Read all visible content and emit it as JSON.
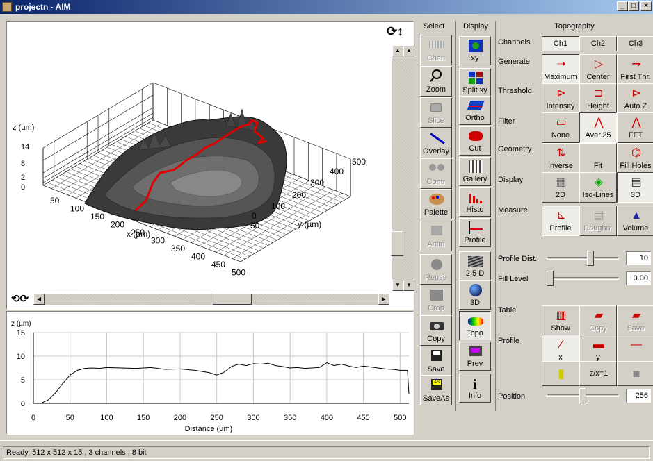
{
  "window": {
    "title": "projectn - AIM",
    "buttons": {
      "minimize": "_",
      "maximize": "□",
      "close": "×"
    }
  },
  "plot3d": {
    "z_label": "z (µm)",
    "x_label": "x (µm)",
    "y_label": "y (µm)",
    "z_ticks": [
      "14",
      "8",
      "2",
      "0"
    ],
    "x_ticks": [
      "50",
      "100",
      "150",
      "200",
      "250",
      "300",
      "350",
      "400",
      "450",
      "500"
    ],
    "y_ticks": [
      "0",
      "100",
      "200",
      "300",
      "400",
      "500"
    ],
    "y_ticks_alt": [
      "50"
    ]
  },
  "chart_data": {
    "type": "line",
    "title": "",
    "xlabel": "Distance (µm)",
    "ylabel": "z (µm)",
    "xlim": [
      0,
      512
    ],
    "ylim": [
      0,
      15
    ],
    "x_ticks": [
      0,
      50,
      100,
      150,
      200,
      250,
      300,
      350,
      400,
      450,
      500
    ],
    "y_ticks": [
      0,
      5,
      10,
      15
    ],
    "grid": true,
    "series": [
      {
        "x": [
          0,
          10,
          20,
          30,
          40,
          50,
          60,
          70,
          80,
          90,
          100,
          120,
          140,
          160,
          180,
          200,
          220,
          240,
          250,
          260,
          270,
          280,
          290,
          300,
          310,
          320,
          330,
          340,
          350,
          360,
          370,
          380,
          390,
          400,
          410,
          420,
          430,
          440,
          450,
          460,
          470,
          480,
          490,
          500,
          510,
          512
        ],
        "y": [
          0,
          0,
          0.7,
          2.2,
          4.2,
          6.0,
          7.0,
          7.4,
          7.5,
          7.4,
          7.6,
          7.5,
          7.4,
          7.6,
          7.2,
          7.3,
          7.0,
          6.5,
          6.0,
          6.6,
          7.8,
          8.3,
          8.0,
          8.4,
          8.3,
          8.5,
          8.0,
          7.8,
          7.5,
          7.6,
          7.4,
          7.5,
          7.6,
          8.6,
          8.0,
          8.3,
          7.9,
          7.6,
          7.9,
          7.7,
          7.5,
          7.3,
          7.2,
          7.0,
          7.0,
          2.0
        ]
      }
    ]
  },
  "select_col": {
    "header": "Select",
    "buttons": [
      "Chan",
      "Zoom",
      "Slice",
      "Overlay",
      "Contr",
      "Palette",
      "Anim",
      "Reuse",
      "Crop",
      "Copy",
      "Save",
      "SaveAs"
    ]
  },
  "display_col": {
    "header": "Display",
    "buttons": [
      "xy",
      "Split xy",
      "Ortho",
      "Cut",
      "Gallery",
      "Histo",
      "Profile",
      "2.5 D",
      "3D",
      "Topo",
      "Prev",
      "Info"
    ]
  },
  "topography": {
    "header": "Topography",
    "rows": {
      "channels": "Channels",
      "generate": "Generate",
      "threshold": "Threshold",
      "filter": "Filter",
      "geometry": "Geometry",
      "display": "Display",
      "measure": "Measure",
      "profile_dist": "Profile Dist.",
      "fill_level": "Fill Level",
      "table": "Table",
      "profile": "Profile",
      "position": "Position"
    },
    "channels": [
      "Ch1",
      "Ch2",
      "Ch3"
    ],
    "generate": [
      "Maximum",
      "Center",
      "First Thr."
    ],
    "threshold": [
      "Intensity",
      "Height",
      "Auto Z"
    ],
    "filter": [
      "None",
      "Aver.25",
      "FFT"
    ],
    "geometry": [
      "Inverse",
      "Fit",
      "Fill Holes"
    ],
    "display": [
      "2D",
      "Iso-Lines",
      "3D"
    ],
    "measure": [
      "Profile",
      "Roughn.",
      "Volume"
    ],
    "table": [
      "Show",
      "Copy",
      "Save"
    ],
    "profile_sub": [
      "x",
      "y",
      ""
    ],
    "profile_dist_value": "10",
    "fill_level_value": "0.00",
    "position_value": "256",
    "profile_dist_fraction": 0.62,
    "fill_level_fraction": 0.0,
    "position_fraction": 0.5
  },
  "status": {
    "text": "Ready, 512 x 512 x 15 , 3 channels , 8 bit"
  }
}
